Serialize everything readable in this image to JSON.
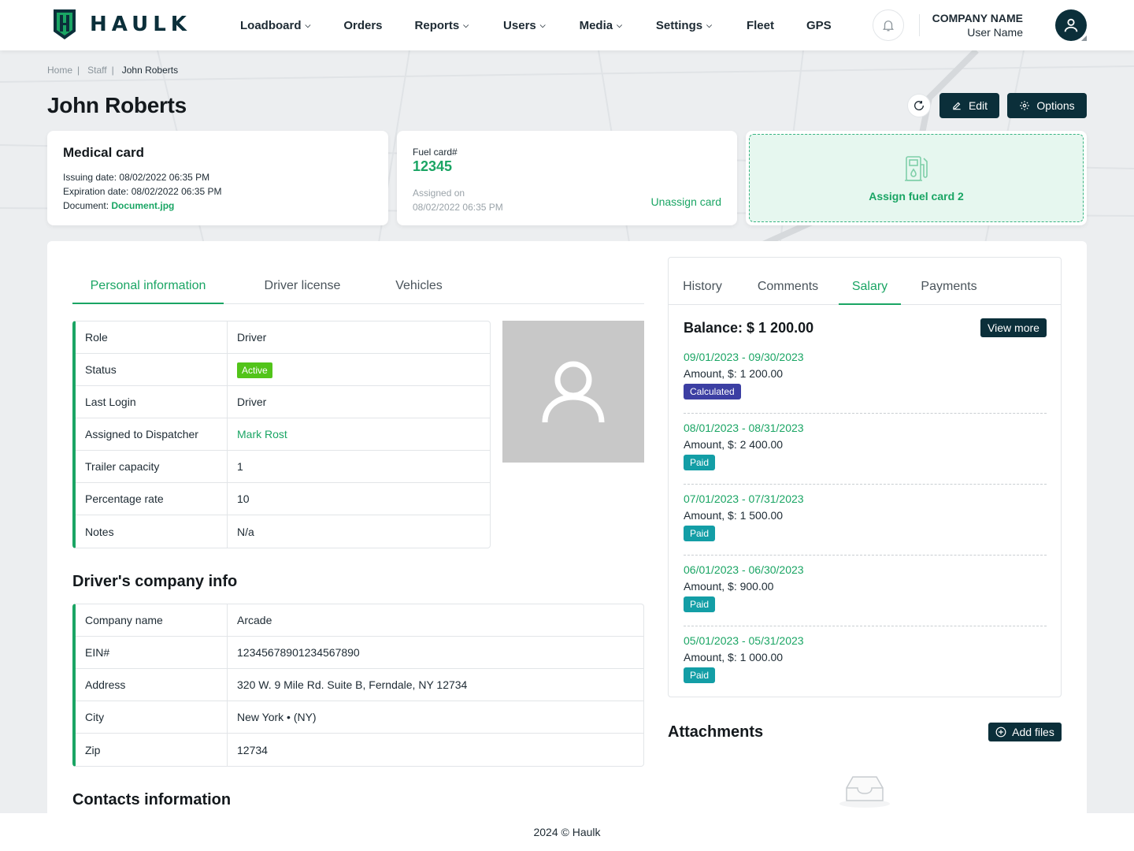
{
  "brand": {
    "name": "HAULK",
    "accent": "#1aa564",
    "dark": "#0b2f3a"
  },
  "nav": [
    {
      "label": "Loadboard",
      "dropdown": true
    },
    {
      "label": "Orders",
      "dropdown": false
    },
    {
      "label": "Reports",
      "dropdown": true
    },
    {
      "label": "Users",
      "dropdown": true
    },
    {
      "label": "Media",
      "dropdown": true
    },
    {
      "label": "Settings",
      "dropdown": true
    },
    {
      "label": "Fleet",
      "dropdown": false
    },
    {
      "label": "GPS",
      "dropdown": false
    }
  ],
  "header": {
    "company_name": "COMPANY NAME",
    "user_name": "User Name"
  },
  "breadcrumb": {
    "home": "Home",
    "staff": "Staff",
    "current": "John Roberts"
  },
  "page": {
    "title": "John Roberts",
    "edit_label": "Edit",
    "options_label": "Options"
  },
  "medical_card": {
    "title": "Medical card",
    "issuing_label": "Issuing date:",
    "issuing_value": "08/02/2022 06:35 PM",
    "expiration_label": "Expiration date:",
    "expiration_value": "08/02/2022 06:35 PM",
    "document_label": "Document:",
    "document_value": "Document.jpg"
  },
  "fuel_card": {
    "label": "Fuel card#",
    "number": "12345",
    "assigned_label": "Assigned on",
    "assigned_value": "08/02/2022 06:35 PM",
    "unassign_label": "Unassign card"
  },
  "assign_card": {
    "label": "Assign fuel card 2"
  },
  "left_tabs": [
    "Personal information",
    "Driver license",
    "Vehicles"
  ],
  "personal_info": {
    "role_label": "Role",
    "role_value": "Driver",
    "status_label": "Status",
    "status_value": "Active",
    "last_login_label": "Last Login",
    "last_login_value": "Driver",
    "dispatcher_label": "Assigned to Dispatcher",
    "dispatcher_value": "Mark Rost",
    "trailer_label": "Trailer capacity",
    "trailer_value": "1",
    "percentage_label": "Percentage rate",
    "percentage_value": "10",
    "notes_label": "Notes",
    "notes_value": "N/a"
  },
  "company_info": {
    "title": "Driver's company info",
    "name_label": "Company name",
    "name_value": "Arcade",
    "ein_label": "EIN#",
    "ein_value": "12345678901234567890",
    "address_label": "Address",
    "address_value": "320 W. 9 Mile Rd. Suite B, Ferndale, NY 12734",
    "city_label": "City",
    "city_value": "New York • (NY)",
    "zip_label": "Zip",
    "zip_value": "12734"
  },
  "contacts": {
    "title": "Contacts information"
  },
  "right_tabs": [
    "History",
    "Comments",
    "Salary",
    "Payments"
  ],
  "salary": {
    "balance": "Balance: $ 1 200.00",
    "view_more_label": "View more",
    "periods": [
      {
        "dates": "09/01/2023 - 09/30/2023",
        "amount": "Amount, $: 1 200.00",
        "status": "Calculated"
      },
      {
        "dates": "08/01/2023 - 08/31/2023",
        "amount": "Amount, $: 2 400.00",
        "status": "Paid"
      },
      {
        "dates": "07/01/2023 - 07/31/2023",
        "amount": "Amount, $: 1 500.00",
        "status": "Paid"
      },
      {
        "dates": "06/01/2023 - 06/30/2023",
        "amount": "Amount, $: 900.00",
        "status": "Paid"
      },
      {
        "dates": "05/01/2023 - 05/31/2023",
        "amount": "Amount, $: 1 000.00",
        "status": "Paid"
      }
    ]
  },
  "attachments": {
    "title": "Attachments",
    "add_label": "Add files"
  },
  "footer": {
    "text": "2024 © Haulk"
  }
}
